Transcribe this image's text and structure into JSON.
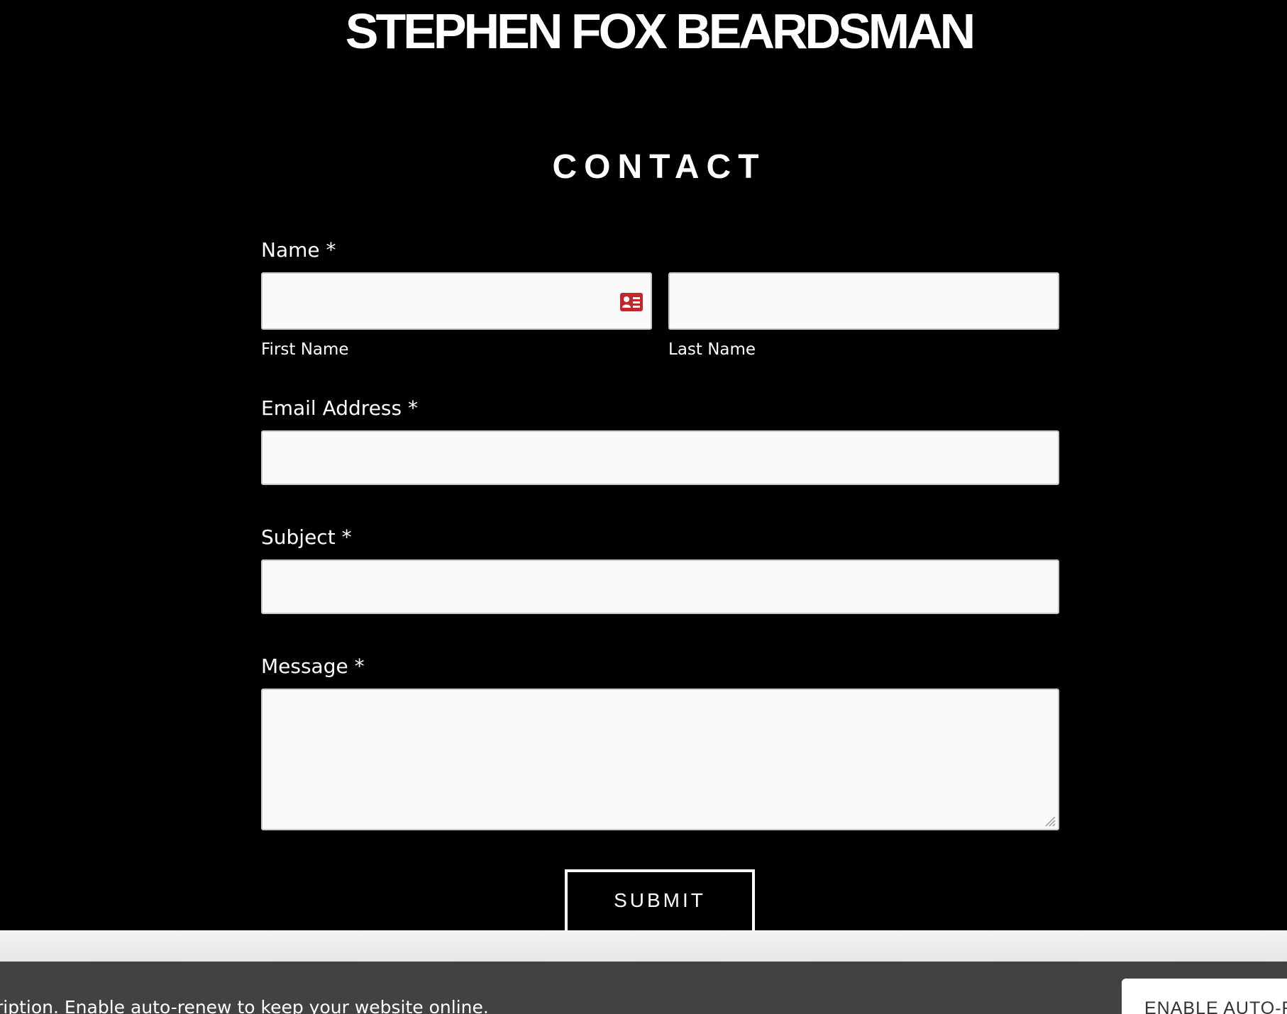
{
  "site": {
    "title": "STEPHEN FOX BEARDSMAN"
  },
  "contact": {
    "heading": "CONTACT",
    "name_label": "Name *",
    "first_name_label": "First Name",
    "last_name_label": "Last Name",
    "first_name_value": "",
    "last_name_value": "",
    "email_label": "Email Address *",
    "email_value": "",
    "subject_label": "Subject *",
    "subject_value": "",
    "message_label": "Message *",
    "message_value": "",
    "submit_label": "SUBMIT",
    "autofill_icon": "id-card-icon"
  },
  "banner": {
    "message": "ription. Enable auto-renew to keep your website online.",
    "button_label": "ENABLE AUTO-RENEW"
  },
  "colors": {
    "page_background": "#000000",
    "text": "#ffffff",
    "field_background": "#fafafa",
    "field_border": "#c9c9c9",
    "autofill_icon": "#c0282d",
    "banner_background": "#424242",
    "banner_button_text": "#333333"
  }
}
